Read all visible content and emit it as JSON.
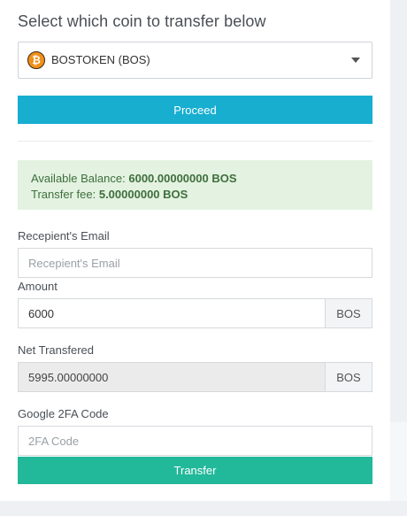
{
  "heading": "Select which coin to transfer below",
  "coin_select": {
    "icon": "bitcoin-icon",
    "icon_glyph": "₿",
    "selected": "BOSTOKEN (BOS)"
  },
  "proceed_label": "Proceed",
  "balance": {
    "available_label": "Available Balance:",
    "available_value": "6000.00000000",
    "available_unit": "BOS",
    "fee_label": "Transfer fee:",
    "fee_value": "5.00000000 BOS"
  },
  "form": {
    "email_label": "Recepient's Email",
    "email_placeholder": "Recepient's Email",
    "amount_label": "Amount",
    "amount_value": "6000",
    "amount_unit": "BOS",
    "net_label": "Net Transfered",
    "net_value": "5995.00000000",
    "net_unit": "BOS",
    "twofa_label": "Google 2FA Code",
    "twofa_placeholder": "2FA Code"
  },
  "transfer_label": "Transfer",
  "colors": {
    "proceed_button": "#17aed0",
    "transfer_button": "#22b89a",
    "balance_box": "#e3f2e1",
    "balance_value": "#2a7bb0"
  }
}
